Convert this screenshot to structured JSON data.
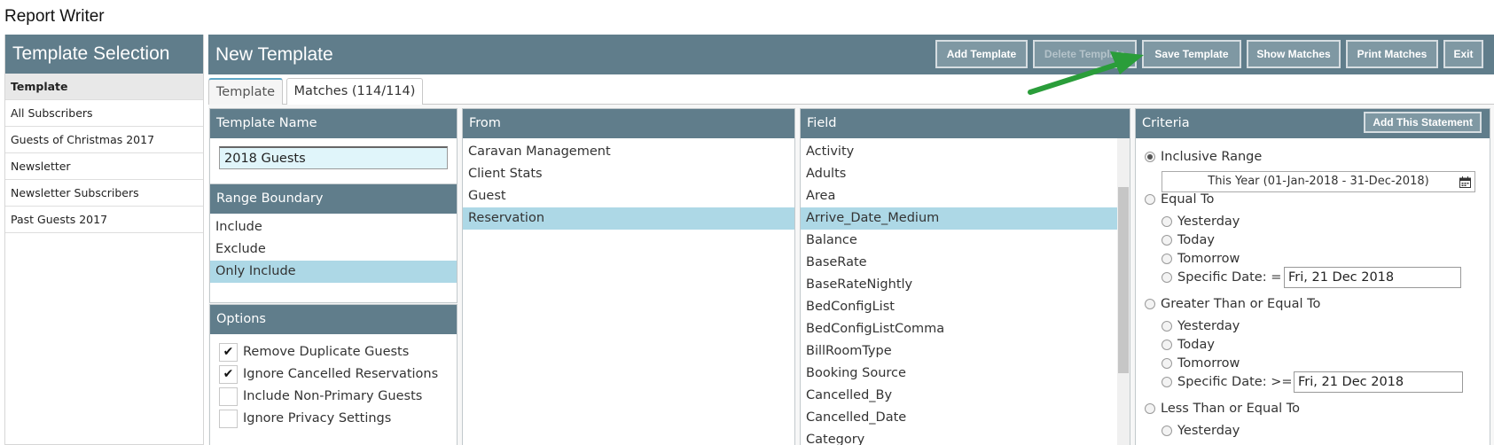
{
  "app": {
    "title": "Report Writer"
  },
  "sidebar": {
    "header": "Template Selection",
    "items": [
      {
        "label": "Template",
        "active": true
      },
      {
        "label": "All Subscribers"
      },
      {
        "label": "Guests of Christmas 2017"
      },
      {
        "label": "Newsletter"
      },
      {
        "label": "Newsletter Subscribers"
      },
      {
        "label": "Past Guests 2017"
      }
    ]
  },
  "header": {
    "title": "New Template",
    "buttons": {
      "add": "Add Template",
      "delete": "Delete Template",
      "save": "Save Template",
      "show": "Show Matches",
      "print": "Print Matches",
      "exit": "Exit"
    }
  },
  "tabs": {
    "template": "Template",
    "matches": "Matches (114/114)"
  },
  "template_name": {
    "head": "Template Name",
    "value": "2018 Guests"
  },
  "range_boundary": {
    "head": "Range Boundary",
    "items": [
      "Include",
      "Exclude",
      "Only Include"
    ],
    "selected": "Only Include"
  },
  "options": {
    "head": "Options",
    "items": [
      {
        "label": "Remove Duplicate Guests",
        "checked": true
      },
      {
        "label": "Ignore Cancelled Reservations",
        "checked": true
      },
      {
        "label": "Include Non-Primary Guests",
        "checked": false
      },
      {
        "label": "Ignore Privacy Settings",
        "checked": false
      }
    ],
    "check_mark": "✔"
  },
  "from": {
    "head": "From",
    "items": [
      "Caravan Management",
      "Client Stats",
      "Guest",
      "Reservation"
    ],
    "selected": "Reservation"
  },
  "field": {
    "head": "Field",
    "items": [
      "Activity",
      "Adults",
      "Area",
      "Arrive_Date_Medium",
      "Balance",
      "BaseRate",
      "BaseRateNightly",
      "BedConfigList",
      "BedConfigListComma",
      "BillRoomType",
      "Booking Source",
      "Cancelled_By",
      "Cancelled_Date",
      "Category"
    ],
    "selected": "Arrive_Date_Medium"
  },
  "criteria": {
    "head": "Criteria",
    "add_button": "Add This Statement",
    "inclusive_range": "Inclusive Range",
    "range_value": "This Year (01-Jan-2018 - 31-Dec-2018)",
    "calendar_icon": "calendar-icon",
    "equal_to": "Equal To",
    "gte": "Greater Than or Equal To",
    "lte": "Less Than or Equal To",
    "yesterday": "Yesterday",
    "today": "Today",
    "tomorrow": "Tomorrow",
    "specific_eq": "Specific Date: =",
    "specific_gte": "Specific Date: >=",
    "date_eq": "Fri, 21 Dec 2018",
    "date_gte": "Fri, 21 Dec 2018"
  },
  "colors": {
    "header": "#607d8b",
    "button": "#7f98a3",
    "selection": "#add8e6",
    "arrow": "#2a9d3a"
  }
}
